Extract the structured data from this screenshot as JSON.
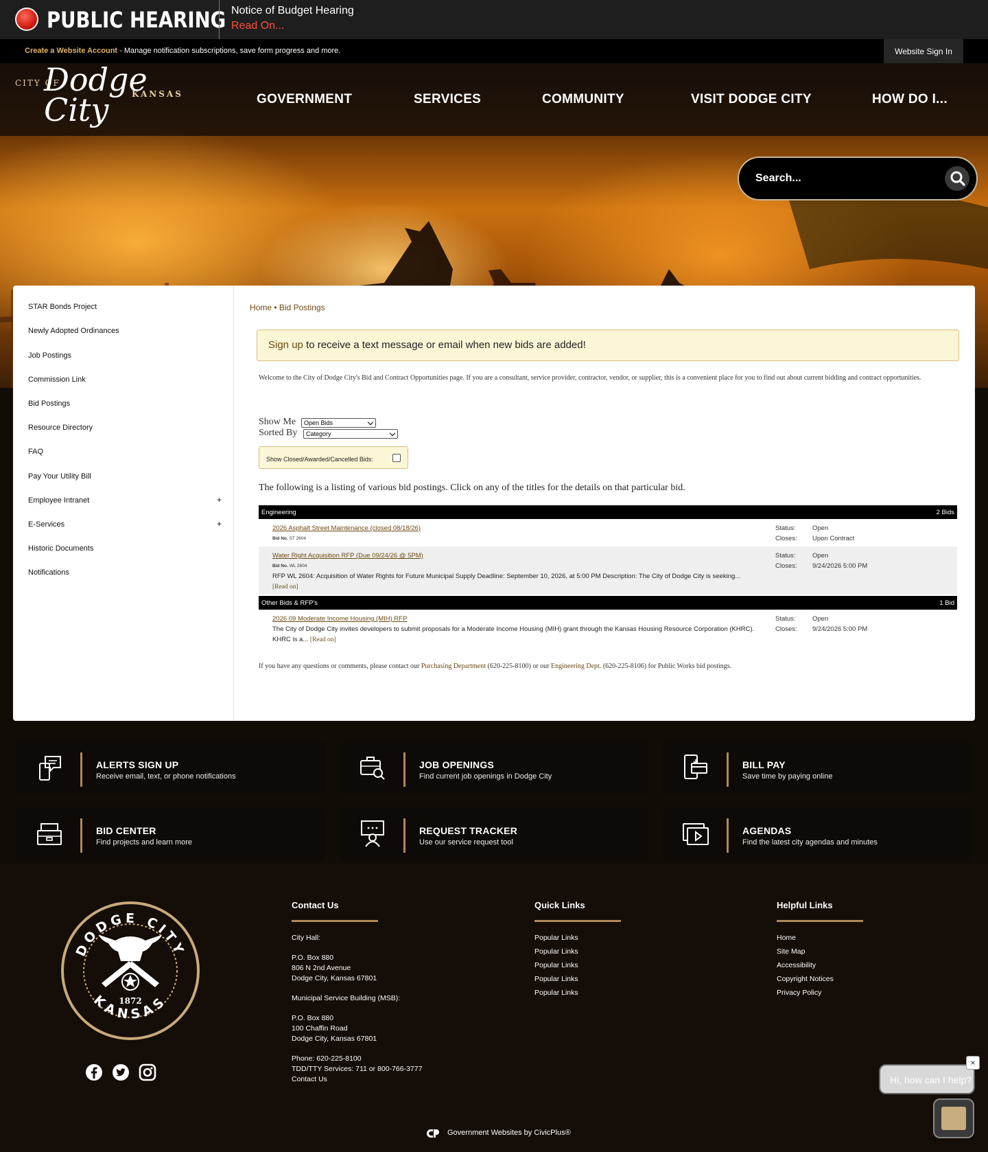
{
  "alert": {
    "title": "PUBLIC HEARING",
    "notice": "Notice of Budget Hearing",
    "read_on": "Read On..."
  },
  "account": {
    "create_link": "Create a Website Account",
    "message": " - Manage notification subscriptions, save form progress and more.",
    "sign_in": "Website Sign In"
  },
  "logo": {
    "city_of": "CITY OF",
    "name": "Dodge City",
    "state": "KANSAS"
  },
  "nav": [
    "GOVERNMENT",
    "SERVICES",
    "COMMUNITY",
    "VISIT DODGE CITY",
    "HOW DO I..."
  ],
  "search": {
    "placeholder": "Search..."
  },
  "sidebar": {
    "items": [
      "STAR Bonds Project",
      "Newly Adopted Ordinances",
      "Job Postings",
      "Commission Link",
      "Bid Postings",
      "Resource Directory",
      "FAQ",
      "Pay Your Utility Bill",
      "Employee Intranet",
      "E-Services",
      "Historic Documents",
      "Notifications"
    ],
    "expand_symbol": "+"
  },
  "breadcrumb": {
    "home": "Home",
    "separator": " • ",
    "current": "Bid Postings"
  },
  "notify": {
    "link": "Sign up",
    "text": " to receive a text message or email when new bids are added!"
  },
  "welcome": "Welcome to the City of Dodge City's Bid and Contract Opportunities page. If you are a consultant, service provider, contractor, vendor, or supplier, this is a convenient place for you to find out about current bidding and contract opportunities.",
  "filters": {
    "show_me_label": "Show Me",
    "show_me_value": "Open Bids",
    "sorted_by_label": "Sorted By",
    "sorted_by_value": "Category",
    "closed_label": "Show Closed/Awarded/Cancelled Bids:"
  },
  "listing_intro": "The following is a listing of various bid postings. Click on any of the titles for the details on that particular bid.",
  "labels": {
    "status": "Status:",
    "closes": "Closes:",
    "bid_no": "Bid No.",
    "read_on": "[Read on]"
  },
  "categories": [
    {
      "name": "Engineering",
      "count": "2 Bids",
      "bids": [
        {
          "title": "2026 Asphalt Street Maintenance (closed 08/18/26)",
          "bid_no": "ST 2604",
          "status": "Open",
          "closes": "Upon Contract"
        },
        {
          "title": "Water Right Acquisition RFP (Due 09/24/26 @ 5PM)",
          "bid_no": "WL 2604",
          "description": "RFP WL 2604: Acquisition of Water Rights for Future Municipal Supply Deadline: September 10, 2026, at 5:00 PM Description: The City of Dodge City is seeking...",
          "status": "Open",
          "closes": "9/24/2026 5:00 PM"
        }
      ]
    },
    {
      "name": "Other Bids & RFP's",
      "count": "1 Bid",
      "bids": [
        {
          "title": "2026 09 Moderate Income Housing (MIH) RFP",
          "description": "The City of Dodge City invites developers to submit proposals for a Moderate Income Housing (MIH) grant through the Kansas Housing Resource Corporation (KHRC). KHRC is a...",
          "status": "Open",
          "closes": "9/24/2026 5:00 PM"
        }
      ]
    }
  ],
  "contact_line": {
    "prefix": "If you have any questions or comments, please contact our ",
    "purchasing": "Purchasing Department",
    "mid": " (620-225-8100) or our ",
    "engineering": "Engineering Dept.",
    "suffix": " (620-225-8106) for Public Works bid postings."
  },
  "tiles": [
    {
      "title": "ALERTS SIGN UP",
      "sub": "Receive email, text, or phone notifications",
      "icon": "phone-chat-icon"
    },
    {
      "title": "JOB OPENINGS",
      "sub": "Find current job openings in Dodge City",
      "icon": "briefcase-search-icon"
    },
    {
      "title": "BILL PAY",
      "sub": "Save time by paying online",
      "icon": "mobile-pay-icon"
    },
    {
      "title": "BID CENTER",
      "sub": "Find projects and learn more",
      "icon": "file-box-icon"
    },
    {
      "title": "REQUEST TRACKER",
      "sub": "Use our service request tool",
      "icon": "support-agent-icon"
    },
    {
      "title": "AGENDAS",
      "sub": "Find the latest city agendas and minutes",
      "icon": "video-agenda-icon"
    }
  ],
  "footer": {
    "seal": {
      "top": "DODGE CITY",
      "year": "1872",
      "bottom": "KANSAS"
    },
    "contact": {
      "heading": "Contact Us",
      "city_hall": "City Hall:",
      "city_hall_box": "P.O. Box 880",
      "city_hall_street": "806 N 2nd Avenue",
      "city_hall_city": "Dodge City, Kansas 67801",
      "msb": "Municipal Service Building (MSB):",
      "msb_box": "P.O. Box 880",
      "msb_street": "100 Chaffin Road",
      "msb_city": "Dodge City, Kansas 67801",
      "phone": "Phone: 620-225-8100",
      "tdd": "TDD/TTY Services: 711 or 800-766-3777",
      "contact_us": "Contact Us"
    },
    "quick_links": {
      "heading": "Quick Links",
      "items": [
        "Popular Links",
        "Popular Links",
        "Popular Links",
        "Popular Links",
        "Popular Links"
      ]
    },
    "helpful_links": {
      "heading": "Helpful Links",
      "items": [
        "Home",
        "Site Map",
        "Accessibility",
        "Copyright Notices",
        "Privacy Policy"
      ]
    },
    "civicplus": "Government Websites by CivicPlus®"
  },
  "chat": {
    "greeting": "Hi, how can I help?",
    "close": "×"
  },
  "colors": {
    "accent": "#b08a58",
    "alert_red": "#ff4e3c",
    "link_brown": "#6b4a12",
    "notice_bg": "#fbf6d6"
  }
}
